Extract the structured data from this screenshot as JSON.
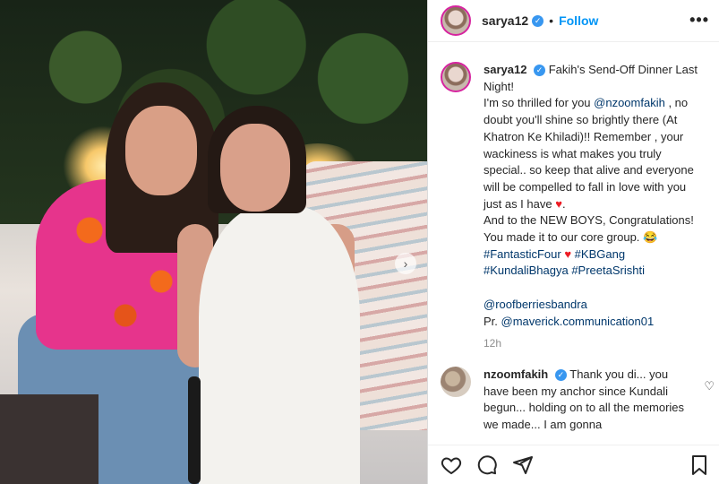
{
  "header": {
    "username": "sarya12",
    "separator": "•",
    "follow_label": "Follow",
    "more_label": "•••"
  },
  "caption": {
    "username": "sarya12",
    "title": "Fakih's Send-Off Dinner Last Night!",
    "line1_pre": "I'm so thrilled for you ",
    "mention1": "@nzoomfakih",
    "line1_post": " , no doubt you'll shine so brightly there (At Khatron Ke Khiladi)!! Remember , your wackiness is what makes you truly special.. so keep that alive and everyone will be compelled to fall in love with you just as I have ",
    "heart": "♥",
    "line1_end": ".",
    "line2": "And to the NEW BOYS, Congratulations! You made it to our core group. 😂",
    "hashtag1": "#FantasticFour",
    "hashtag2": "#KBGang",
    "hashtag3": "#KundaliBhagya",
    "hashtag4": "#PreetaSrishti",
    "mention2": "@roofberriesbandra",
    "pr_label": "Pr. ",
    "mention3": "@maverick.communication01",
    "time": "12h"
  },
  "comment": {
    "username": "nzoomfakih",
    "text": "Thank you di... you have been my anchor since Kundali begun... holding on to all the memories we made... I am gonna"
  },
  "icons": {
    "verified": "✓",
    "next": "›",
    "comment_heart": "♡"
  },
  "colors": {
    "accent": "#0095f6",
    "verified": "#3897f0",
    "link": "#00376b",
    "heart": "#ed1c24"
  }
}
